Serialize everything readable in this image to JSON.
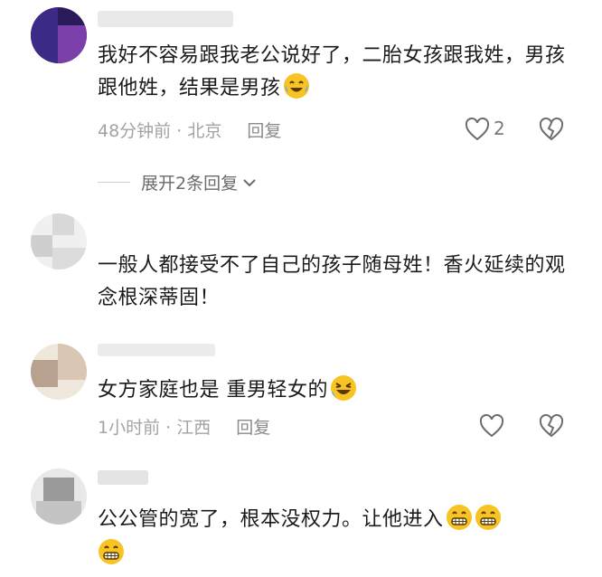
{
  "comments": [
    {
      "text": "我好不容易跟我老公说好了，二胎女孩跟我姓，男孩跟他姓，结果是男孩",
      "emoji": [
        "crying-laughing-emoji"
      ],
      "time": "48分钟前",
      "location": "北京",
      "reply_label": "回复",
      "like_count": "2"
    },
    {
      "text": "一般人都接受不了自己的孩子随母姓！香火延续的观念根深蒂固！",
      "emoji": []
    },
    {
      "text": "女方家庭也是  重男轻女的",
      "emoji": [
        "rofl-emoji"
      ],
      "time": "1小时前",
      "location": "江西",
      "reply_label": "回复"
    },
    {
      "text": "公公管的宽了，根本没权力。让他进入",
      "emoji": [
        "grinning-emoji",
        "grinning-emoji",
        "grinning-emoji"
      ]
    }
  ],
  "expand_replies_label": "展开2条回复",
  "colors": {
    "emoji_yellow": "#F7C325",
    "meta_gray": "#A3A3A3",
    "text": "#1B1B1B"
  }
}
